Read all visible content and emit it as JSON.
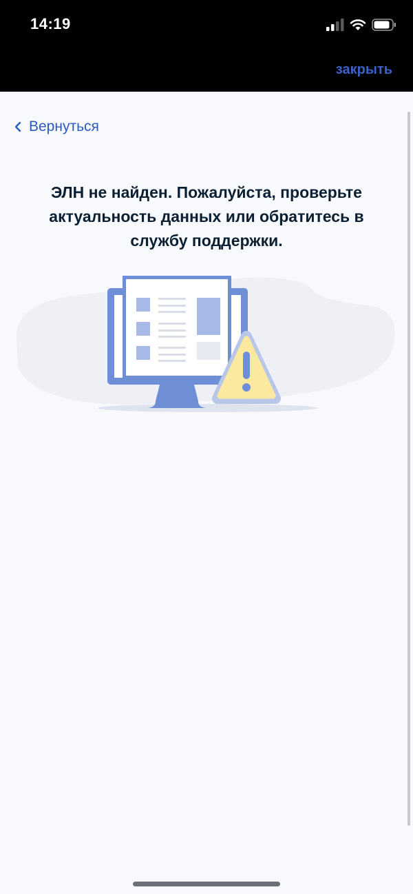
{
  "status_bar": {
    "time": "14:19"
  },
  "header": {
    "close_label": "закрыть"
  },
  "nav": {
    "back_label": "Вернуться"
  },
  "content": {
    "message_lines": [
      "ЭЛН не найден. Пожалуйста, проверьте",
      "актуальность данных или обратитесь в",
      "службу поддержки."
    ]
  },
  "colors": {
    "accent": "#2b59c3",
    "warning_fill": "#fbe9a0",
    "illustration_blue": "#6e8fd6",
    "background": "#f8f9fd"
  },
  "icons": {
    "back": "chevron-left-icon",
    "illustration": "computer-warning-illustration"
  }
}
